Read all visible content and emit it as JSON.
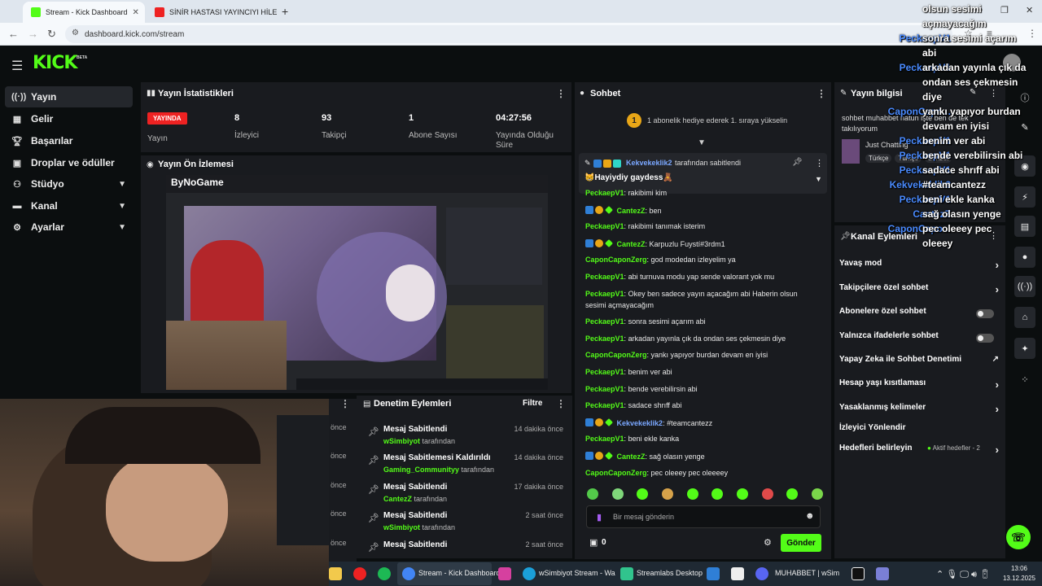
{
  "browser": {
    "tabs": [
      {
        "title": "Stream - Kick Dashboard"
      },
      {
        "title": "SİNİR HASTASI YAYINCIYI HİLEY"
      }
    ],
    "url": "dashboard.kick.com/stream"
  },
  "header": {
    "logo": "KICK",
    "beta": "BETA"
  },
  "sidebar": {
    "items": [
      {
        "label": "Yayın",
        "icon": "stream-icon"
      },
      {
        "label": "Gelir",
        "icon": "revenue-icon"
      },
      {
        "label": "Başarılar",
        "icon": "trophy-icon"
      },
      {
        "label": "Droplar ve ödüller",
        "icon": "gift-icon"
      },
      {
        "label": "Stüdyo",
        "icon": "studio-icon"
      },
      {
        "label": "Kanal",
        "icon": "channel-icon"
      },
      {
        "label": "Ayarlar",
        "icon": "gear-icon"
      }
    ]
  },
  "stats": {
    "title": "Yayın İstatistikleri",
    "live_badge": "YAYINDA",
    "live_label": "Yayın",
    "viewers": "8",
    "viewers_label": "İzleyici",
    "followers": "93",
    "followers_label": "Takipçi",
    "subs": "1",
    "subs_label": "Abone Sayısı",
    "duration": "04:27:56",
    "duration_label": "Yayında Olduğu Süre"
  },
  "preview": {
    "title": "Yayın Ön İzlemesi",
    "brand": "ByNoGame"
  },
  "mod_actions": {
    "title": "Denetim Eylemleri",
    "filter": "Filtre",
    "by_suffix": "tarafından",
    "rows": [
      {
        "action": "Mesaj Sabitlendi",
        "time": "14 dakika önce",
        "user": "wSimbiyot"
      },
      {
        "action": "Mesaj Sabitlemesi Kaldırıldı",
        "time": "14 dakika önce",
        "user": "Gaming_Communityy"
      },
      {
        "action": "Mesaj Sabitlendi",
        "time": "17 dakika önce",
        "user": "CantezZ"
      },
      {
        "action": "Mesaj Sabitlendi",
        "time": "2 saat önce",
        "user": "wSimbiyot"
      },
      {
        "action": "Mesaj Sabitlendi",
        "time": "2 saat önce",
        "user": ""
      }
    ],
    "left_times": [
      "önce",
      "önce",
      "önce",
      "önce",
      "önce"
    ]
  },
  "chat": {
    "title": "Sohbet",
    "sub_banner": "1 abonelik hediye ederek 1. sıraya yükselin",
    "pinned_by_user": "Kekvekeklik2",
    "pinned_by_text": "tarafından sabitlendi",
    "pinned_message": "Hayiydiy gaydess",
    "messages": [
      {
        "user": "PeckaepV1",
        "text": "rakibimi kim",
        "color": "#53fc18"
      },
      {
        "user": "CantezZ",
        "text": "ben",
        "color": "#53fc18",
        "badges": true
      },
      {
        "user": "PeckaepV1",
        "text": "rakibimi tanımak isterim",
        "color": "#53fc18"
      },
      {
        "user": "CantezZ",
        "text": "Karpuzlu Fuystí#3rdm1",
        "color": "#53fc18",
        "badges": true
      },
      {
        "user": "CaponCaponZerg",
        "text": "god modedan izleyelim ya",
        "color": "#53fc18"
      },
      {
        "user": "PeckaepV1",
        "text": "abi turnuva modu yap sende valorant yok mu",
        "color": "#53fc18"
      },
      {
        "user": "PeckaepV1",
        "text": "Okey ben sadece yayın açacağım abi Haberin olsun",
        "color": "#53fc18",
        "cont": "sesimi açmayacağım"
      },
      {
        "user": "PeckaepV1",
        "text": "sonra sesimi açarım abi",
        "color": "#53fc18"
      },
      {
        "user": "PeckaepV1",
        "text": "arkadan yayınla çık da ondan ses çekmesin diye",
        "color": "#53fc18"
      },
      {
        "user": "CaponCaponZerg",
        "text": "yankı yapıyor burdan devam en iyisi",
        "color": "#53fc18"
      },
      {
        "user": "PeckaepV1",
        "text": "benim ver abi",
        "color": "#53fc18"
      },
      {
        "user": "PeckaepV1",
        "text": "bende verebilirsin abi",
        "color": "#53fc18"
      },
      {
        "user": "PeckaepV1",
        "text": "sadace shrıff abi",
        "color": "#53fc18"
      },
      {
        "user": "Kekvekeklik2",
        "text": "#teamcantezz",
        "color": "#7aa7ff",
        "badges": true
      },
      {
        "user": "PeckaepV1",
        "text": "beni ekle kanka",
        "color": "#53fc18"
      },
      {
        "user": "CantezZ",
        "text": "sağ olasın yenge",
        "color": "#53fc18",
        "badges": true
      },
      {
        "user": "CaponCaponZerg",
        "text": "pec oleeey pec oleeeey",
        "color": "#53fc18"
      }
    ],
    "input_placeholder": "Bir mesaj gönderin",
    "points": "0",
    "send": "Gönder"
  },
  "stream_info": {
    "title": "Yayın bilgisi",
    "text": "sohbet muhabbet hatun işte ben de tek takılıyorum",
    "category": "Just Chatting",
    "tags": [
      "Türkçe",
      "Türkçe",
      "Sohbet"
    ]
  },
  "channel_actions": {
    "title": "Kanal Eylemleri",
    "rows": [
      {
        "label": "Yavaş mod",
        "kind": "arrow"
      },
      {
        "label": "Takipçilere özel sohbet",
        "kind": "arrow"
      },
      {
        "label": "Abonelere özel sohbet",
        "kind": "toggle"
      },
      {
        "label": "Yalnızca ifadelerle sohbet",
        "kind": "toggle"
      },
      {
        "label": "Yapay Zeka ile Sohbet Denetimi",
        "kind": "link"
      },
      {
        "label": "Hesap yaşı kısıtlaması",
        "kind": "arrow"
      },
      {
        "label": "Yasaklanmış kelimeler",
        "kind": "arrow"
      },
      {
        "label": "İzleyici Yönlendir",
        "kind": "none"
      },
      {
        "label": "Hedefleri belirleyin",
        "kind": "arrow"
      }
    ],
    "goals_active": "Aktif hedefler - 2"
  },
  "overlay": [
    {
      "user": "",
      "text": "olsun sesimi"
    },
    {
      "user": "",
      "text": "açmayacağım"
    },
    {
      "user": "PeckaepV1",
      "text": "sonra sesimi açarım"
    },
    {
      "user": "",
      "text": "abi"
    },
    {
      "user": "PeckaepV1",
      "text": "arkadan yayınla çık da"
    },
    {
      "user": "",
      "text": "ondan ses çekmesin"
    },
    {
      "user": "",
      "text": "diye"
    },
    {
      "user": "CaponCapo...",
      "text": "yankı yapıyor burdan"
    },
    {
      "user": "",
      "text": "devam en iyisi"
    },
    {
      "user": "PeckaepV1",
      "text": "benim ver abi"
    },
    {
      "user": "PeckaepV1",
      "text": "bende verebilirsin abi"
    },
    {
      "user": "PeckaepV1",
      "text": "sadace shrıff abi"
    },
    {
      "user": "Kekvekeklik2",
      "text": "#teamcantezz"
    },
    {
      "user": "PeckaepV1",
      "text": "beni ekle kanka"
    },
    {
      "user": "CantezZ",
      "text": "sağ olasın yenge"
    },
    {
      "user": "CaponCapo...",
      "text": "pec oleeey pec"
    },
    {
      "user": "",
      "text": "oleeey"
    }
  ],
  "taskbar": {
    "items": [
      "Stream - Kick Dashboard",
      "wSimbiyot Stream - Wa",
      "Streamlabs Desktop",
      "MUHABBET | wSim"
    ],
    "time": "13:06",
    "date": "13.12.2025"
  }
}
